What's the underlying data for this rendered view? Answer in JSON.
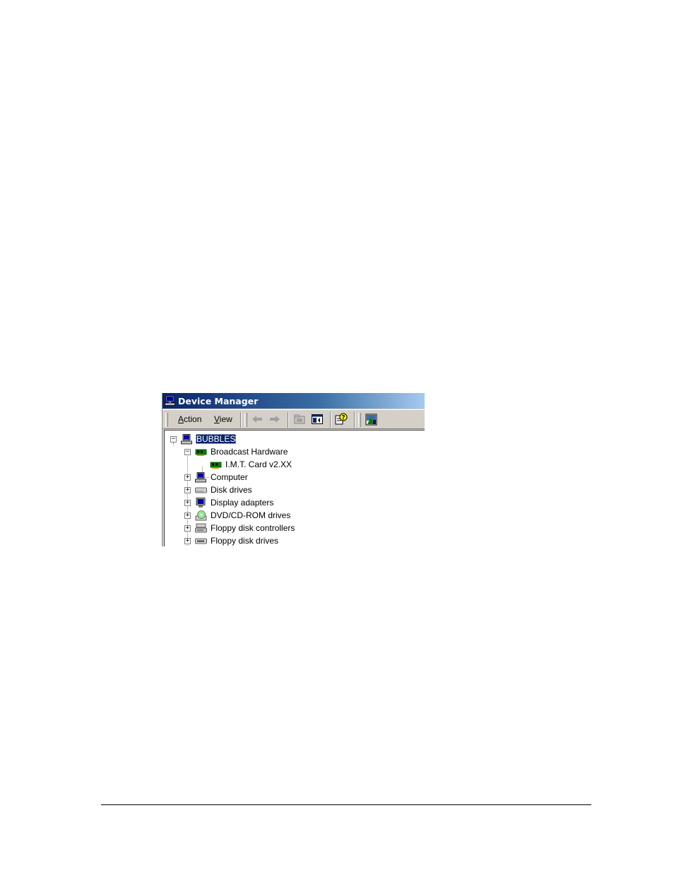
{
  "window": {
    "title": "Device Manager"
  },
  "menu": {
    "action": {
      "accel": "A",
      "rest": "ction"
    },
    "view": {
      "accel": "V",
      "rest": "iew"
    }
  },
  "toolbar": {
    "buttons": [
      "back-arrow-icon",
      "forward-arrow-icon",
      "up-folder-icon",
      "show-hide-tree-icon",
      "help-icon",
      "properties-icon"
    ]
  },
  "tree": {
    "root": {
      "label": "BUBBLES",
      "icon": "computer-icon",
      "expanded": true,
      "selected": true
    },
    "broadcast": {
      "label": "Broadcast Hardware",
      "icon": "card-icon",
      "expanded": true
    },
    "imt_card": {
      "label": "I.M.T. Card v2.XX",
      "icon": "card-icon"
    },
    "computer": {
      "label": "Computer",
      "icon": "computer-icon",
      "expanded": false
    },
    "disk_drives": {
      "label": "Disk drives",
      "icon": "disk-drive-icon",
      "expanded": false
    },
    "display_adapters": {
      "label": "Display adapters",
      "icon": "monitor-icon",
      "expanded": false
    },
    "dvd": {
      "label": "DVD/CD-ROM drives",
      "icon": "cdrom-icon",
      "expanded": false
    },
    "floppy_ctrl": {
      "label": "Floppy disk controllers",
      "icon": "floppy-controller-icon",
      "expanded": false
    },
    "floppy_drives": {
      "label": "Floppy disk drives",
      "icon": "floppy-drive-icon",
      "expanded": false
    }
  },
  "colors": {
    "title_gradient_start": "#0a246a",
    "title_gradient_end": "#a6caf0",
    "selection": "#0a246a",
    "chrome": "#d4d0c8"
  }
}
